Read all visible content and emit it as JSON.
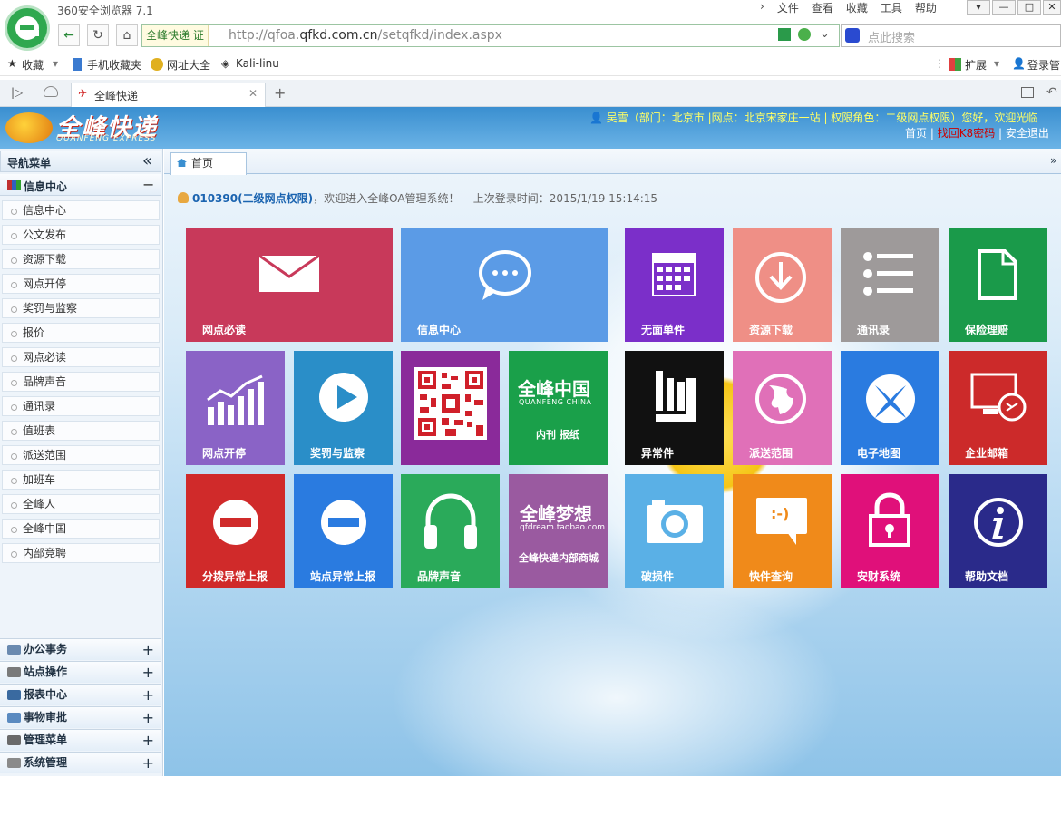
{
  "browser": {
    "app_title": "360安全浏览器 7.1",
    "menus": [
      "文件",
      "查看",
      "收藏",
      "工具",
      "帮助"
    ],
    "site_badge": "全峰快递 证",
    "url_host_prefix": "http://qfoa.",
    "url_host_main": "qfkd.com.cn",
    "url_path": "/setqfkd/index.aspx",
    "search_placeholder": "点此搜索",
    "favorites": [
      "收藏",
      "手机收藏夹",
      "网址大全",
      "Kali-linu"
    ],
    "fav_right": [
      "扩展",
      "登录管"
    ],
    "tab_title": "全峰快递"
  },
  "header": {
    "brand_name": "全峰快递",
    "brand_sub": "QUANFENG EXPRESS",
    "user_line": "吴雪（部门：北京市 |网点：北京宋家庄一站 | 权限角色：二级网点权限）您好，欢迎光临",
    "link_home": "首页",
    "link_recover": "找回K8密码",
    "link_logout": "安全退出"
  },
  "sidebar": {
    "title": "导航菜单",
    "section_info": "信息中心",
    "items": [
      "信息中心",
      "公文发布",
      "资源下载",
      "网点开停",
      "奖罚与监察",
      "报价",
      "网点必读",
      "品牌声音",
      "通讯录",
      "值班表",
      "派送范围",
      "加班车",
      "全峰人",
      "全峰中国",
      "内部竞聘"
    ],
    "sections": [
      "办公事务",
      "站点操作",
      "报表中心",
      "事物审批",
      "管理菜单",
      "系统管理"
    ]
  },
  "main": {
    "tab_home": "首页",
    "welcome_user": "010390(二级网点权限)",
    "welcome_text": "，欢迎进入全峰OA管理系统！",
    "last_login": "上次登录时间：2015/1/19 15:14:15"
  },
  "tiles": {
    "t1": "网点必读",
    "t2": "信息中心",
    "t3": "无面单件",
    "t4": "资源下载",
    "t5": "通讯录",
    "t6": "保险理赔",
    "t7": "网点开停",
    "t8": "奖罚与监察",
    "t10_title": "全峰中国",
    "t10_sub": "QUANFENG CHINA",
    "t10_lbl": "内刊 报纸",
    "t11": "异常件",
    "t12": "派送范围",
    "t13": "电子地图",
    "t14": "企业邮箱",
    "t15": "分拨异常上报",
    "t16": "站点异常上报",
    "t17": "品牌声音",
    "t18_title": "全峰梦想",
    "t18_sub": "qfdream.taobao.com",
    "t18_lbl": "全峰快递内部商城",
    "t19": "破损件",
    "t20": "快件查询",
    "t21": "安财系统",
    "t22": "帮助文档",
    "t20_face": ":-)"
  },
  "colors": {
    "accent": "#3a8fd0",
    "t1": "#c8395a",
    "t2": "#5b9be6",
    "t3": "#7b2fc9",
    "t4": "#ef8f86",
    "t5": "#9e9a9a",
    "t6": "#1a9a4a",
    "t7": "#8a63c6",
    "t8": "#2a8ec8",
    "t9": "#8a2a9a",
    "t10": "#1aa04a",
    "t11": "#111111",
    "t12": "#e070b8",
    "t13": "#2a7be0",
    "t14": "#cc2a2a",
    "t15": "#d02a2a",
    "t16": "#2a7be0",
    "t17": "#2aaa5a",
    "t18": "#9a5aa0",
    "t19": "#5ab0e6",
    "t20": "#f08a1a",
    "t21": "#e0107a",
    "t22": "#2a2a8a"
  }
}
